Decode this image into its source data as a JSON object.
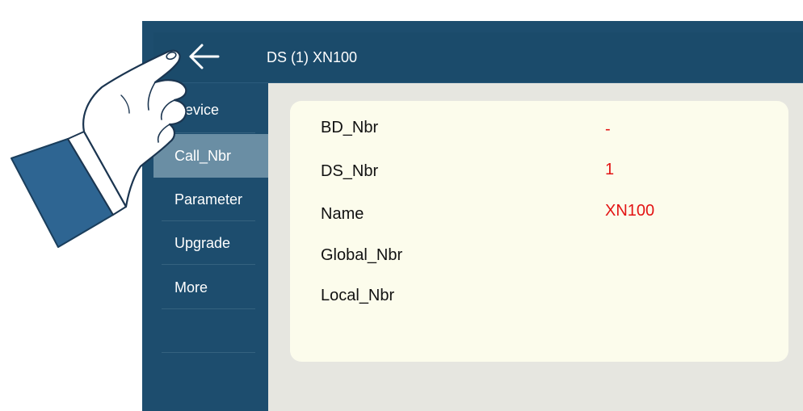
{
  "header": {
    "title": "DS (1) XN100",
    "back_icon": "arrow-left-icon"
  },
  "sidebar": {
    "items": [
      {
        "label": "Device",
        "active": false
      },
      {
        "label": "Call_Nbr",
        "active": true
      },
      {
        "label": "Parameter",
        "active": false
      },
      {
        "label": "Upgrade",
        "active": false
      },
      {
        "label": "More",
        "active": false
      }
    ]
  },
  "details": {
    "rows": [
      {
        "label": "BD_Nbr",
        "value": "-"
      },
      {
        "label": "DS_Nbr",
        "value": "1"
      },
      {
        "label": "Name",
        "value": "XN100"
      },
      {
        "label": "Global_Nbr",
        "value": ""
      },
      {
        "label": "Local_Nbr",
        "value": ""
      }
    ]
  },
  "colors": {
    "frame": "#1d4d6e",
    "active_item": "#6a8ea4",
    "panel_bg": "#e6e6e0",
    "card_bg": "#fcfcec",
    "value_text": "#e31414"
  }
}
